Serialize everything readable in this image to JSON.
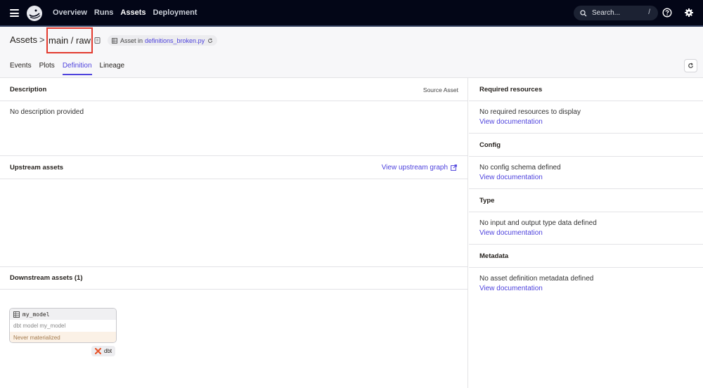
{
  "nav": {
    "links": [
      "Overview",
      "Runs",
      "Assets",
      "Deployment"
    ],
    "active": "Assets",
    "search_placeholder": "Search...",
    "search_shortcut": "/"
  },
  "header": {
    "breadcrumb_root": "Assets",
    "breadcrumb_sep": ">",
    "breadcrumb_current": "main / raw",
    "chip_prefix": "Asset in",
    "chip_file": "definitions_broken.py",
    "tabs": [
      "Events",
      "Plots",
      "Definition",
      "Lineage"
    ],
    "active_tab": "Definition"
  },
  "description": {
    "title": "Description",
    "badge": "Source Asset",
    "text": "No description provided"
  },
  "upstream": {
    "title": "Upstream assets",
    "link": "View upstream graph"
  },
  "downstream": {
    "title": "Downstream assets (1)",
    "node": {
      "name": "my_model",
      "description": "dbt model my_model",
      "status": "Never materialized",
      "tag": "dbt"
    }
  },
  "resources": {
    "title": "Required resources",
    "text": "No required resources to display",
    "link": "View documentation"
  },
  "config": {
    "title": "Config",
    "text": "No config schema defined",
    "link": "View documentation"
  },
  "type": {
    "title": "Type",
    "text": "No input and output type data defined",
    "link": "View documentation"
  },
  "metadata": {
    "title": "Metadata",
    "text": "No asset definition metadata defined",
    "link": "View documentation"
  },
  "colors": {
    "accent": "#4f43dd",
    "nav_bg": "#030617",
    "highlight": "#e23a2e"
  }
}
